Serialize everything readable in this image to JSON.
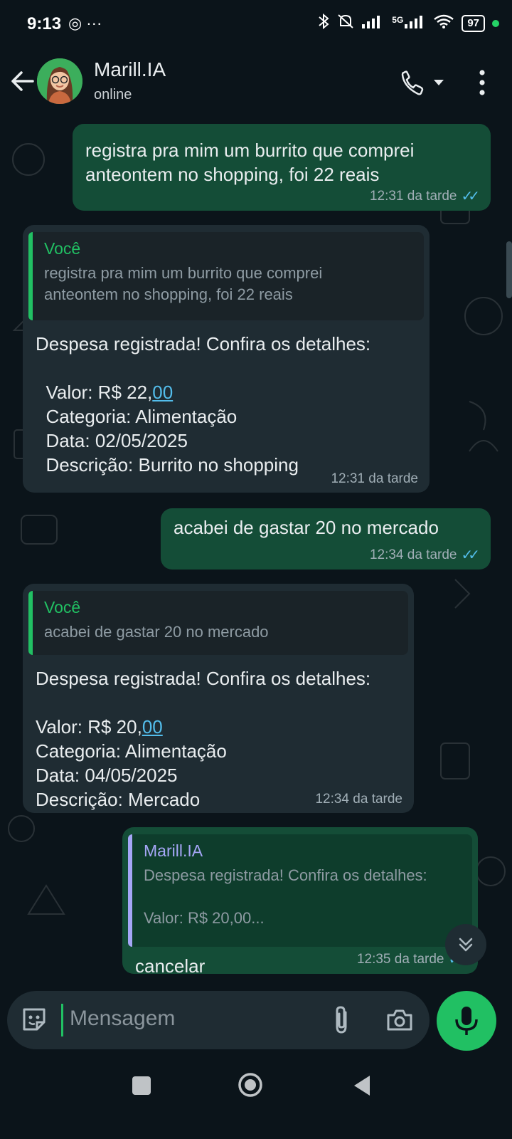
{
  "status_bar": {
    "time": "9:13",
    "extra_icons": "◎ ···",
    "network": "5G",
    "battery": "97"
  },
  "header": {
    "contact_name": "Marill.IA",
    "contact_status": "online"
  },
  "messages": [
    {
      "direction": "out",
      "text": "registra pra mim um burrito que comprei\nanteontem no shopping, foi 22 reais",
      "time": "12:31 da tarde",
      "status": "read"
    },
    {
      "direction": "in",
      "quote_author": "Você",
      "quote_text": "registra pra mim um burrito que comprei\nanteontem no shopping, foi 22 reais",
      "heading": "Despesa registrada! Confira os detalhes:",
      "valor_prefix": "  Valor: R$ 22,",
      "valor_link": "00",
      "categoria": "  Categoria: Alimentação",
      "data": "  Data: 02/05/2025",
      "descricao": "  Descrição: Burrito no shopping",
      "time": "12:31 da tarde"
    },
    {
      "direction": "out",
      "text": "acabei de gastar 20 no mercado",
      "time": "12:34 da tarde",
      "status": "read"
    },
    {
      "direction": "in",
      "quote_author": "Você",
      "quote_text": "acabei de gastar 20 no mercado",
      "heading": "Despesa registrada! Confira os detalhes:",
      "valor_prefix": "Valor: R$ 20,",
      "valor_link": "00",
      "categoria": "Categoria: Alimentação",
      "data": "Data: 04/05/2025",
      "descricao": "Descrição: Mercado",
      "time": "12:34 da tarde"
    },
    {
      "direction": "out",
      "quote_author": "Marill.IA",
      "quote_text": "Despesa registrada! Confira os detalhes:\n\nValor: R$ 20,00...",
      "text": "cancelar",
      "time": "12:35 da tarde",
      "status": "read"
    }
  ],
  "composer": {
    "placeholder": "Mensagem"
  },
  "colors": {
    "background": "#0b141a",
    "outgoing_bubble": "#144d37",
    "incoming_bubble": "#1f2c33",
    "accent": "#21c063",
    "link": "#53bdeb"
  }
}
